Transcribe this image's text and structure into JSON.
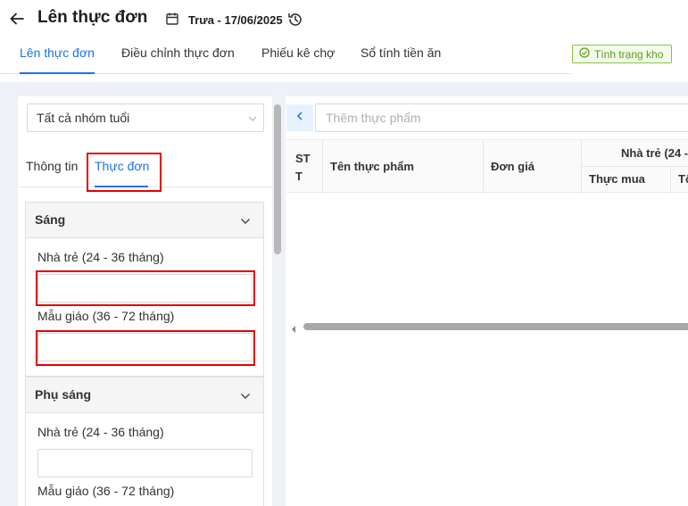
{
  "header": {
    "title": "Lên thực đơn",
    "meal_date": "Trưa - 17/06/2025"
  },
  "tabs": [
    {
      "label": "Lên thực đơn",
      "active": true
    },
    {
      "label": "Điều chỉnh thực đơn",
      "active": false
    },
    {
      "label": "Phiếu kê chợ",
      "active": false
    },
    {
      "label": "Sổ tính tiền ăn",
      "active": false
    }
  ],
  "stock_button": {
    "label": "Tình trạng kho",
    "color": "#5a9a1f"
  },
  "left": {
    "age_group": "Tất cả nhóm tuổi",
    "subtabs": [
      {
        "label": "Thông tin",
        "active": false
      },
      {
        "label": "Thực đơn",
        "active": true
      }
    ],
    "sections": [
      {
        "title": "Sáng",
        "fields": [
          {
            "label": "Nhà trẻ (24 - 36 tháng)",
            "value": ""
          },
          {
            "label": "Mẫu giáo (36 - 72 tháng)",
            "value": ""
          }
        ]
      },
      {
        "title": "Phụ sáng",
        "fields": [
          {
            "label": "Nhà trẻ (24 - 36 tháng)",
            "value": ""
          },
          {
            "label": "Mẫu giáo (36 - 72 tháng)",
            "value": ""
          }
        ]
      }
    ]
  },
  "right": {
    "add_food_placeholder": "Thêm thực phẩm",
    "table": {
      "col_stt": "ST T",
      "col_name": "Tên thực phẩm",
      "col_price": "Đơn giá",
      "group_header": "Nhà trẻ (24 -",
      "sub_col_buy": "Thực mua",
      "sub_col_total": "Tổ"
    }
  },
  "colors": {
    "accent": "#1a73e8",
    "highlight": "#e60000"
  }
}
